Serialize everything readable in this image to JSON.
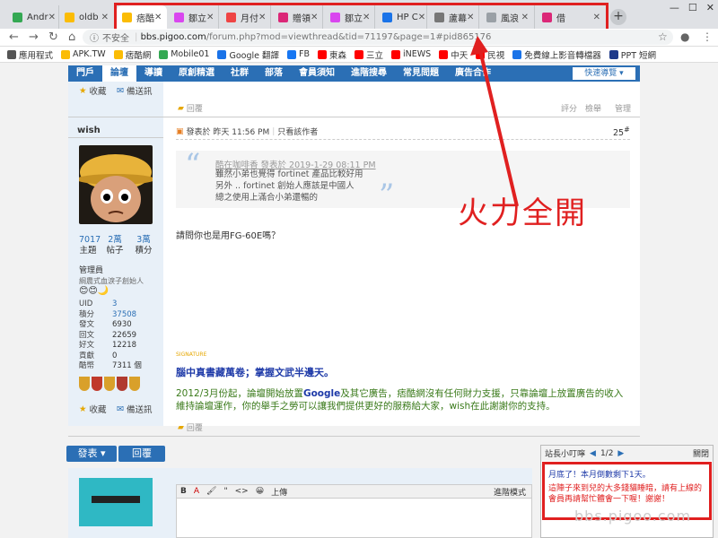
{
  "browser": {
    "tabs": [
      {
        "label": "Andr",
        "fav": "#34a853"
      },
      {
        "label": "oldb",
        "fav": "#fbbc05"
      },
      {
        "label": "痞酷",
        "fav": "#fbbc05"
      },
      {
        "label": "鄒立",
        "fav": "#d946ef"
      },
      {
        "label": "月付",
        "fav": "#ef4444"
      },
      {
        "label": "贈領",
        "fav": "#db2777"
      },
      {
        "label": "鄒立",
        "fav": "#d946ef"
      },
      {
        "label": "HP C",
        "fav": "#1a73e8"
      },
      {
        "label": "蘆幕",
        "fav": "#777777"
      },
      {
        "label": "風浪",
        "fav": "#9aa0a6"
      },
      {
        "label": "借",
        "fav": "#db2777"
      }
    ],
    "address": {
      "insecure": "不安全",
      "host": "bbs.pigoo.com",
      "path": "/forum.php?mod=viewthread&tid=71197&page=1#pid865176"
    },
    "bookmarks": [
      {
        "label": "應用程式",
        "color": "#555555"
      },
      {
        "label": "APK.TW",
        "color": "#fbbc05"
      },
      {
        "label": "痞酷網",
        "color": "#fbbc05"
      },
      {
        "label": "Mobile01",
        "color": "#34a853"
      },
      {
        "label": "Google 翻譯",
        "color": "#1a73e8"
      },
      {
        "label": "FB",
        "color": "#1877f2"
      },
      {
        "label": "東森",
        "color": "#ff0000"
      },
      {
        "label": "三立",
        "color": "#ff0000"
      },
      {
        "label": "iNEWS",
        "color": "#ff0000"
      },
      {
        "label": "中天",
        "color": "#ff0000"
      },
      {
        "label": "民視",
        "color": "#ff0000"
      },
      {
        "label": "免費線上影音轉檔器",
        "color": "#1a73e8"
      },
      {
        "label": "PPT 短網",
        "color": "#1e3a8a"
      }
    ]
  },
  "forum": {
    "nav": [
      "門戶",
      "論壇",
      "導讀",
      "原創精選",
      "社群",
      "部落",
      "會員須知",
      "進階搜尋",
      "常見問題",
      "廣告合作"
    ],
    "quick_nav": "快速導覽 ▾",
    "collect": "收藏",
    "reply_notify": "備送訊",
    "reply": "回覆",
    "rate": "評分",
    "report": "檢舉",
    "manage": "管理",
    "post": {
      "author": "wish",
      "posted": "發表於 昨天 11:56 PM",
      "only_author": "只看該作者",
      "floor": "25",
      "quote_head": "酷在咖啡香 發表於 2019-1-29 08:11 PM",
      "quote_lines": [
        "雖然小弟也覺得 fortinet 產品比較好用",
        "另外 .. fortinet 創始人應該是中國人",
        "總之使用上滿合小弟還暢的"
      ],
      "body": "請問你也是用FG-60E嗎？"
    },
    "user": {
      "stats": [
        {
          "value": "7017",
          "label": "主題"
        },
        {
          "value": "2萬",
          "label": "帖子"
        },
        {
          "value": "3萬",
          "label": "積分"
        }
      ],
      "group": "管理員",
      "subtitle": "綱農式血淚子創始人",
      "badges": "😊😊🌙",
      "details": [
        {
          "k": "UID",
          "v": "3"
        },
        {
          "k": "積分",
          "v": "37508"
        },
        {
          "k": "發文",
          "v": "6930"
        },
        {
          "k": "回文",
          "v": "22659"
        },
        {
          "k": "好文",
          "v": "12218"
        },
        {
          "k": "貢獻",
          "v": "0"
        },
        {
          "k": "酷幣",
          "v": "7311 個"
        }
      ]
    },
    "signature": "SIGNATURE",
    "ad_title": "腦中真書藏萬卷；掌握文武半邊天。",
    "ad_text_1": "2012/3月份起，論壇開始放置",
    "ad_text_google": "Google",
    "ad_text_2": "及其它廣告，痞酷網沒有任何財力支援，只靠論壇上放置廣告的收入維持論壇運作，你的舉手之勞可以讓我們提供更好的服務給大家，wish在此謝謝你的支持。",
    "btn_post": "發表 ▾",
    "btn_reply": "回覆",
    "editor_tools": [
      "B",
      "A",
      "🖌",
      "\"",
      "<>",
      "😀",
      "上傳"
    ],
    "editor_mode": "進階模式"
  },
  "annotation": {
    "label": "火力全開",
    "color": "#e02020"
  },
  "popup": {
    "title": "站長小叮嚀",
    "pager": "1/2",
    "close": "關閉",
    "line1": "月底了！本月倒數剩下1天。",
    "line2": "這陣子來到兒的大多錢貓睡暗，請有上線的會員再請幫忙體會一下喔！謝謝！"
  },
  "watermark": "bbs.pigoo.com"
}
